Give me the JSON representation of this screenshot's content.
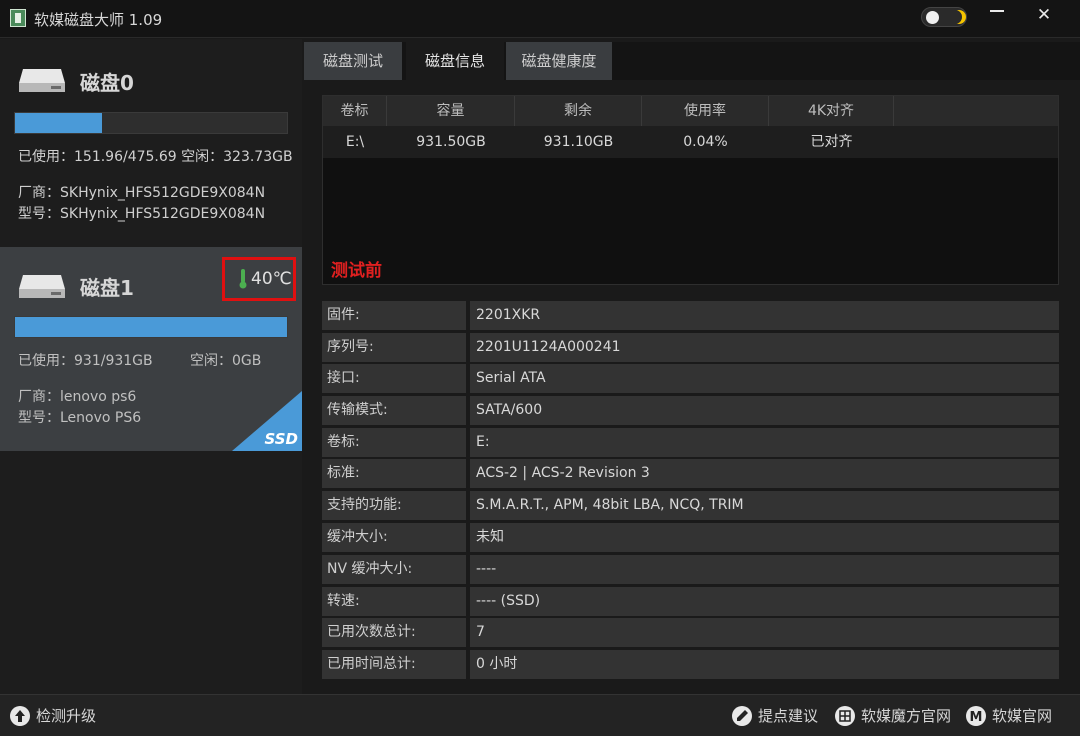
{
  "app": {
    "title": "软媒磁盘大师 1.09"
  },
  "colors": {
    "accent": "#4a9ad8",
    "highlight_red": "#e01010",
    "selected_card": "#3c3f42"
  },
  "disks": [
    {
      "name": "磁盘0",
      "usage_percent": 32,
      "usage_text": "已使用：151.96/475.69 空闲：323.73GB",
      "vendor_text": "厂商：SKHynix_HFS512GDE9X084N",
      "model_text": "型号：SKHynix_HFS512GDE9X084N"
    },
    {
      "name": "磁盘1",
      "temperature": "40℃",
      "usage_percent": 100,
      "usage_used": "已使用：931/931GB",
      "usage_free": "空闲：0GB",
      "vendor_text": "厂商：lenovo ps6",
      "model_text": "型号：Lenovo PS6",
      "badge": "SSD"
    }
  ],
  "tabs": [
    {
      "label": "磁盘测试",
      "active": false
    },
    {
      "label": "磁盘信息",
      "active": true
    },
    {
      "label": "磁盘健康度",
      "active": false
    }
  ],
  "volume_table": {
    "headers": [
      "卷标",
      "容量",
      "剩余",
      "使用率",
      "4K对齐"
    ],
    "rows": [
      [
        "E:\\",
        "931.50GB",
        "931.10GB",
        "0.04%",
        "已对齐"
      ]
    ]
  },
  "before_label": "测试前",
  "properties": [
    {
      "key": "固件:",
      "value": "2201XKR"
    },
    {
      "key": "序列号:",
      "value": "2201U1124A000241"
    },
    {
      "key": "接口:",
      "value": "Serial ATA"
    },
    {
      "key": "传输模式:",
      "value": "SATA/600"
    },
    {
      "key": "卷标:",
      "value": "E:"
    },
    {
      "key": "标准:",
      "value": "ACS-2 | ACS-2 Revision 3"
    },
    {
      "key": "支持的功能:",
      "value": "S.M.A.R.T., APM, 48bit LBA, NCQ, TRIM"
    },
    {
      "key": "缓冲大小:",
      "value": "未知"
    },
    {
      "key": "NV 缓冲大小:",
      "value": "----"
    },
    {
      "key": "转速:",
      "value": "---- (SSD)"
    },
    {
      "key": "已用次数总计:",
      "value": "7"
    },
    {
      "key": "已用时间总计:",
      "value": "0 小时"
    }
  ],
  "footer": {
    "upgrade": "检测升级",
    "feedback": "提点建议",
    "mofang": "软媒魔方官网",
    "official": "软媒官网"
  }
}
